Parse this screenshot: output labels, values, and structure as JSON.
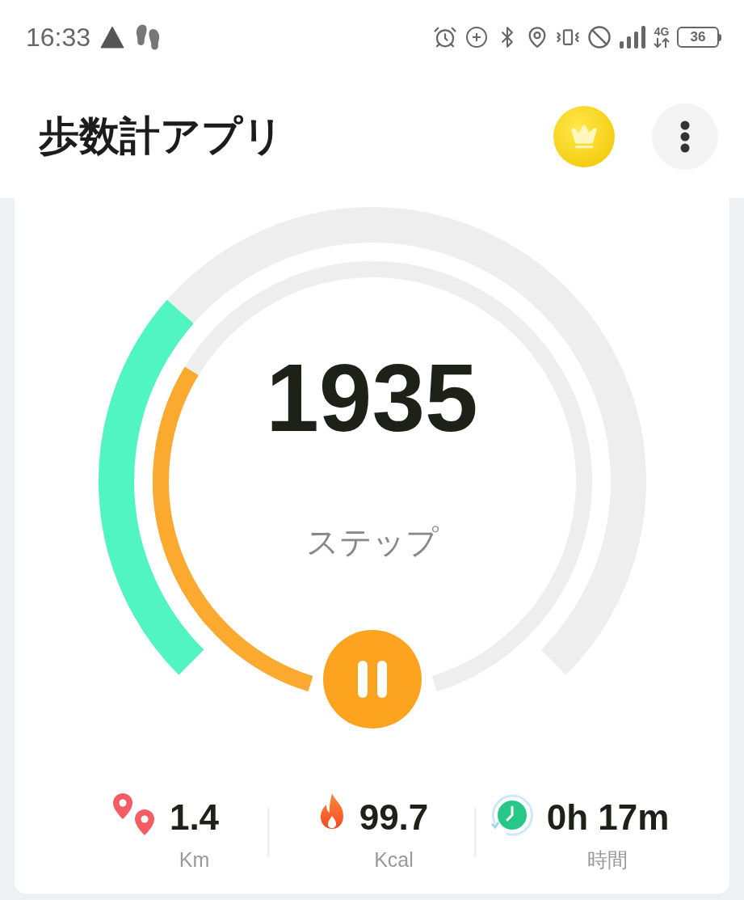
{
  "status_bar": {
    "time": "16:33",
    "network": "4G",
    "battery": "36"
  },
  "app_bar": {
    "title": "歩数計アプリ"
  },
  "gauge": {
    "steps": "1935",
    "unit": "ステップ",
    "running": true
  },
  "stats": [
    {
      "kind": "distance",
      "value": "1.4",
      "unit": "Km"
    },
    {
      "kind": "calories",
      "value": "99.7",
      "unit": "Kcal"
    },
    {
      "kind": "time",
      "value": "0h 17m",
      "unit": "時間"
    }
  ]
}
